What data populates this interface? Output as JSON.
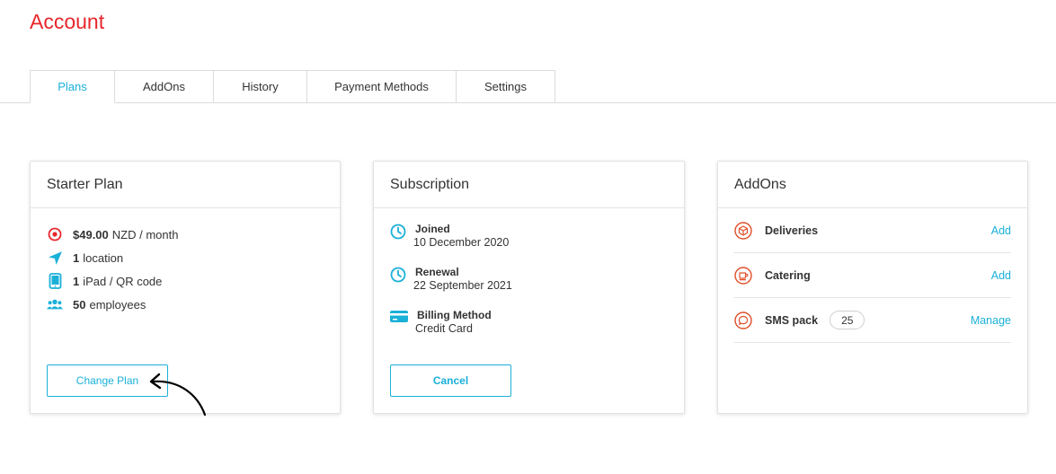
{
  "page": {
    "title": "Account"
  },
  "tabs": [
    {
      "label": "Plans",
      "active": true
    },
    {
      "label": "AddOns",
      "active": false
    },
    {
      "label": "History",
      "active": false
    },
    {
      "label": "Payment Methods",
      "active": false
    },
    {
      "label": "Settings",
      "active": false
    }
  ],
  "plan_card": {
    "title": "Starter Plan",
    "items": [
      {
        "icon": "target-icon",
        "strong": "$49.00",
        "text": "NZD / month"
      },
      {
        "icon": "location-arrow-icon",
        "strong": "1",
        "text": "location"
      },
      {
        "icon": "tablet-icon",
        "strong": "1",
        "text": "iPad / QR code"
      },
      {
        "icon": "users-icon",
        "strong": "50",
        "text": "employees"
      }
    ],
    "button_label": "Change Plan"
  },
  "subscription_card": {
    "title": "Subscription",
    "items": [
      {
        "icon": "clock-icon",
        "label": "Joined",
        "value": "10 December 2020"
      },
      {
        "icon": "clock-icon",
        "label": "Renewal",
        "value": "22 September 2021"
      },
      {
        "icon": "credit-card-icon",
        "label": "Billing Method",
        "value": "Credit Card"
      }
    ],
    "button_label": "Cancel"
  },
  "addons_card": {
    "title": "AddOns",
    "items": [
      {
        "icon": "box-icon",
        "name": "Deliveries",
        "badge": "",
        "action": "Add"
      },
      {
        "icon": "coffee-cup-icon",
        "name": "Catering",
        "badge": "",
        "action": "Add"
      },
      {
        "icon": "chat-bubble-icon",
        "name": "SMS pack",
        "badge": "25",
        "action": "Manage"
      }
    ]
  },
  "colors": {
    "accent": "#1ab0d8",
    "brand": "#e8262b",
    "addon_icon": "#e0502a"
  }
}
